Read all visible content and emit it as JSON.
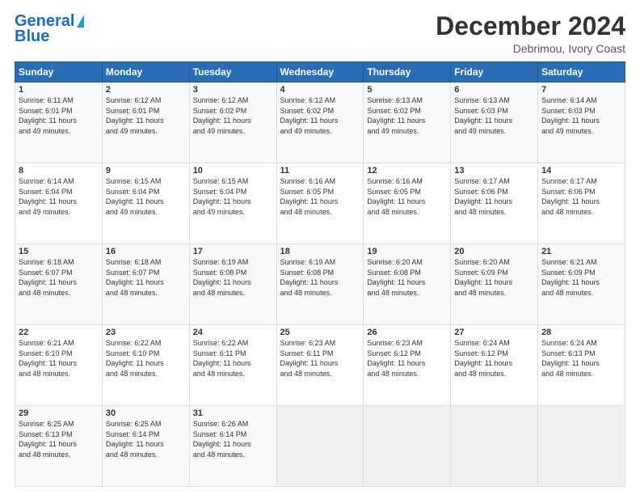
{
  "logo": {
    "line1": "General",
    "line2": "Blue"
  },
  "title": "December 2024",
  "subtitle": "Debrimou, Ivory Coast",
  "days_of_week": [
    "Sunday",
    "Monday",
    "Tuesday",
    "Wednesday",
    "Thursday",
    "Friday",
    "Saturday"
  ],
  "weeks": [
    [
      {
        "day": 1,
        "rise": "6:11 AM",
        "set": "6:01 PM",
        "hours": "11 hours",
        "mins": "49 minutes"
      },
      {
        "day": 2,
        "rise": "6:12 AM",
        "set": "6:01 PM",
        "hours": "11 hours",
        "mins": "49 minutes"
      },
      {
        "day": 3,
        "rise": "6:12 AM",
        "set": "6:02 PM",
        "hours": "11 hours",
        "mins": "49 minutes"
      },
      {
        "day": 4,
        "rise": "6:12 AM",
        "set": "6:02 PM",
        "hours": "11 hours",
        "mins": "49 minutes"
      },
      {
        "day": 5,
        "rise": "6:13 AM",
        "set": "6:02 PM",
        "hours": "11 hours",
        "mins": "49 minutes"
      },
      {
        "day": 6,
        "rise": "6:13 AM",
        "set": "6:03 PM",
        "hours": "11 hours",
        "mins": "49 minutes"
      },
      {
        "day": 7,
        "rise": "6:14 AM",
        "set": "6:03 PM",
        "hours": "11 hours",
        "mins": "49 minutes"
      }
    ],
    [
      {
        "day": 8,
        "rise": "6:14 AM",
        "set": "6:04 PM",
        "hours": "11 hours",
        "mins": "49 minutes"
      },
      {
        "day": 9,
        "rise": "6:15 AM",
        "set": "6:04 PM",
        "hours": "11 hours",
        "mins": "49 minutes"
      },
      {
        "day": 10,
        "rise": "6:15 AM",
        "set": "6:04 PM",
        "hours": "11 hours",
        "mins": "49 minutes"
      },
      {
        "day": 11,
        "rise": "6:16 AM",
        "set": "6:05 PM",
        "hours": "11 hours",
        "mins": "48 minutes"
      },
      {
        "day": 12,
        "rise": "6:16 AM",
        "set": "6:05 PM",
        "hours": "11 hours",
        "mins": "48 minutes"
      },
      {
        "day": 13,
        "rise": "6:17 AM",
        "set": "6:06 PM",
        "hours": "11 hours",
        "mins": "48 minutes"
      },
      {
        "day": 14,
        "rise": "6:17 AM",
        "set": "6:06 PM",
        "hours": "11 hours",
        "mins": "48 minutes"
      }
    ],
    [
      {
        "day": 15,
        "rise": "6:18 AM",
        "set": "6:07 PM",
        "hours": "11 hours",
        "mins": "48 minutes"
      },
      {
        "day": 16,
        "rise": "6:18 AM",
        "set": "6:07 PM",
        "hours": "11 hours",
        "mins": "48 minutes"
      },
      {
        "day": 17,
        "rise": "6:19 AM",
        "set": "6:08 PM",
        "hours": "11 hours",
        "mins": "48 minutes"
      },
      {
        "day": 18,
        "rise": "6:19 AM",
        "set": "6:08 PM",
        "hours": "11 hours",
        "mins": "48 minutes"
      },
      {
        "day": 19,
        "rise": "6:20 AM",
        "set": "6:08 PM",
        "hours": "11 hours",
        "mins": "48 minutes"
      },
      {
        "day": 20,
        "rise": "6:20 AM",
        "set": "6:09 PM",
        "hours": "11 hours",
        "mins": "48 minutes"
      },
      {
        "day": 21,
        "rise": "6:21 AM",
        "set": "6:09 PM",
        "hours": "11 hours",
        "mins": "48 minutes"
      }
    ],
    [
      {
        "day": 22,
        "rise": "6:21 AM",
        "set": "6:10 PM",
        "hours": "11 hours",
        "mins": "48 minutes"
      },
      {
        "day": 23,
        "rise": "6:22 AM",
        "set": "6:10 PM",
        "hours": "11 hours",
        "mins": "48 minutes"
      },
      {
        "day": 24,
        "rise": "6:22 AM",
        "set": "6:11 PM",
        "hours": "11 hours",
        "mins": "48 minutes"
      },
      {
        "day": 25,
        "rise": "6:23 AM",
        "set": "6:11 PM",
        "hours": "11 hours",
        "mins": "48 minutes"
      },
      {
        "day": 26,
        "rise": "6:23 AM",
        "set": "6:12 PM",
        "hours": "11 hours",
        "mins": "48 minutes"
      },
      {
        "day": 27,
        "rise": "6:24 AM",
        "set": "6:12 PM",
        "hours": "11 hours",
        "mins": "48 minutes"
      },
      {
        "day": 28,
        "rise": "6:24 AM",
        "set": "6:13 PM",
        "hours": "11 hours",
        "mins": "48 minutes"
      }
    ],
    [
      {
        "day": 29,
        "rise": "6:25 AM",
        "set": "6:13 PM",
        "hours": "11 hours",
        "mins": "48 minutes"
      },
      {
        "day": 30,
        "rise": "6:25 AM",
        "set": "6:14 PM",
        "hours": "11 hours",
        "mins": "48 minutes"
      },
      {
        "day": 31,
        "rise": "6:26 AM",
        "set": "6:14 PM",
        "hours": "11 hours",
        "mins": "48 minutes"
      },
      null,
      null,
      null,
      null
    ]
  ]
}
